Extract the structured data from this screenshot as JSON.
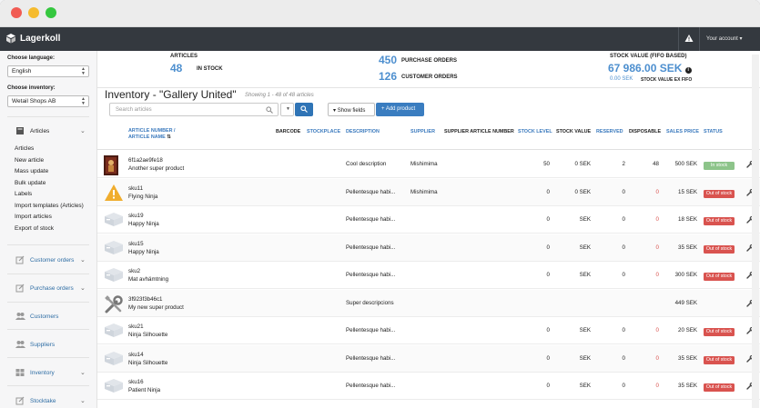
{
  "topbar": {
    "brand": "Lagerkoll",
    "account": "Your account"
  },
  "sidebar": {
    "language_label": "Choose language:",
    "language_value": "English",
    "inventory_label": "Choose inventory:",
    "inventory_value": "Wetail Shops AB",
    "articles_section": "Articles",
    "article_links": [
      "Articles",
      "New article",
      "Mass update",
      "Bulk update",
      "Labels",
      "Import templates (Articles)",
      "Import articles",
      "Export of stock"
    ],
    "sections": [
      "Customer orders",
      "Purchase orders",
      "Customers",
      "Suppliers",
      "Inventory",
      "Stocktake"
    ]
  },
  "stats": {
    "articles_label": "ARTICLES",
    "articles_count": "48",
    "in_stock_label": "IN STOCK",
    "purchase_orders_count": "450",
    "purchase_orders_label": "PURCHASE ORDERS",
    "customer_orders_count": "126",
    "customer_orders_label": "CUSTOMER ORDERS",
    "stock_value_label": "STOCK VALUE (FIFO BASED)",
    "stock_value": "67 986.00 SEK",
    "stock_value_ex": "0.00 SEK",
    "stock_value_ex_label": "STOCK VALUE EX FIFO"
  },
  "page": {
    "title": "Inventory - \"Gallery United\"",
    "showing": "Showing 1 - 48 of 48 articles",
    "search_placeholder": "Search articles",
    "show_fields": "Show fields",
    "add_product": "+ Add product"
  },
  "columns": {
    "article_number": "ARTICLE NUMBER /",
    "article_name": "ARTICLE NAME",
    "barcode": "BARCODE",
    "stockplace": "STOCKPLACE",
    "description": "DESCRIPTION",
    "supplier": "SUPPLIER",
    "supplier_article_number": "SUPPLIER ARTICLE NUMBER",
    "stock_level": "STOCK LEVEL",
    "stock_value": "STOCK VALUE",
    "reserved": "RESERVED",
    "disposable": "DISPOSABLE",
    "sales_price": "SALES PRICE",
    "status": "STATUS"
  },
  "rows": [
    {
      "sku": "6f1a2ae9fe18",
      "name": "Another super product",
      "thumb": "photo-thumbnail",
      "description": "Cool description",
      "supplier": "Mishimima",
      "stock_level": "50",
      "stock_value": "0 SEK",
      "reserved": "2",
      "disposable": "48",
      "disposable_negative": false,
      "sales_price": "500 SEK",
      "status": "In stock",
      "status_type": "in"
    },
    {
      "sku": "sku11",
      "name": "Flying Ninja",
      "thumb": "warning-icon",
      "description": "Pellentesque habi...",
      "supplier": "Mishimima",
      "stock_level": "0",
      "stock_value": "0 SEK",
      "reserved": "0",
      "disposable": "0",
      "disposable_negative": true,
      "sales_price": "15 SEK",
      "status": "Out of stock",
      "status_type": "out"
    },
    {
      "sku": "sku19",
      "name": "Happy Ninja",
      "thumb": "box-placeholder-icon",
      "description": "Pellentesque habi...",
      "supplier": "",
      "stock_level": "0",
      "stock_value": "SEK",
      "reserved": "0",
      "disposable": "0",
      "disposable_negative": true,
      "sales_price": "18 SEK",
      "status": "Out of stock",
      "status_type": "out"
    },
    {
      "sku": "sku15",
      "name": "Happy Ninja",
      "thumb": "box-placeholder-icon",
      "description": "Pellentesque habi...",
      "supplier": "",
      "stock_level": "0",
      "stock_value": "SEK",
      "reserved": "0",
      "disposable": "0",
      "disposable_negative": true,
      "sales_price": "35 SEK",
      "status": "Out of stock",
      "status_type": "out"
    },
    {
      "sku": "sku2",
      "name": "Mat avhämtning",
      "thumb": "box-placeholder-icon",
      "description": "Pellentesque habi...",
      "supplier": "",
      "stock_level": "0",
      "stock_value": "SEK",
      "reserved": "0",
      "disposable": "0",
      "disposable_negative": true,
      "sales_price": "300 SEK",
      "status": "Out of stock",
      "status_type": "out"
    },
    {
      "sku": "3f923f3b46c1",
      "name": "My new super product",
      "thumb": "tools-icon",
      "description": "Super descripcions",
      "supplier": "",
      "stock_level": "",
      "stock_value": "",
      "reserved": "",
      "disposable": "",
      "disposable_negative": false,
      "sales_price": "449 SEK",
      "status": "",
      "status_type": "none"
    },
    {
      "sku": "sku21",
      "name": "Ninja Silhouette",
      "thumb": "box-placeholder-icon",
      "description": "Pellentesque habi...",
      "supplier": "",
      "stock_level": "0",
      "stock_value": "SEK",
      "reserved": "0",
      "disposable": "0",
      "disposable_negative": true,
      "sales_price": "20 SEK",
      "status": "Out of stock",
      "status_type": "out"
    },
    {
      "sku": "sku14",
      "name": "Ninja Silhouette",
      "thumb": "box-placeholder-icon",
      "description": "Pellentesque habi...",
      "supplier": "",
      "stock_level": "0",
      "stock_value": "SEK",
      "reserved": "0",
      "disposable": "0",
      "disposable_negative": true,
      "sales_price": "35 SEK",
      "status": "Out of stock",
      "status_type": "out"
    },
    {
      "sku": "sku16",
      "name": "Patient Ninja",
      "thumb": "box-placeholder-icon",
      "description": "Pellentesque habi...",
      "supplier": "",
      "stock_level": "0",
      "stock_value": "SEK",
      "reserved": "0",
      "disposable": "0",
      "disposable_negative": true,
      "sales_price": "35 SEK",
      "status": "Out of stock",
      "status_type": "out"
    }
  ],
  "colors": {
    "accent": "#3a7dc0",
    "topbar": "#34393f",
    "in_stock": "#8dc48a",
    "out_of_stock": "#d9534f",
    "stat_number": "#4d8fcf"
  }
}
